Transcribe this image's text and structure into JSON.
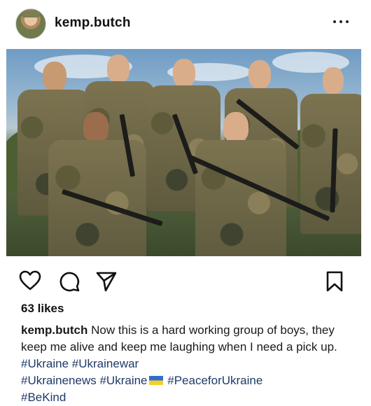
{
  "post": {
    "username": "kemp.butch",
    "more_icon": "more-horizontal-icon",
    "actions": {
      "like_icon": "heart-icon",
      "comment_icon": "comment-icon",
      "share_icon": "send-icon",
      "save_icon": "bookmark-icon"
    },
    "likes_text": "63 likes",
    "caption": {
      "username": "kemp.butch",
      "text": " Now this is a hard working group of boys, they keep me alive and keep me laughing when I need a pick up. ",
      "tags": [
        "#Ukraine",
        "#Ukrainewar",
        "#Ukrainenews",
        "#Ukraine",
        "#PeaceforUkraine",
        "#BeKind"
      ]
    },
    "colors": {
      "hashtag": "#1f3a6a",
      "text": "#1a1a1a"
    }
  }
}
